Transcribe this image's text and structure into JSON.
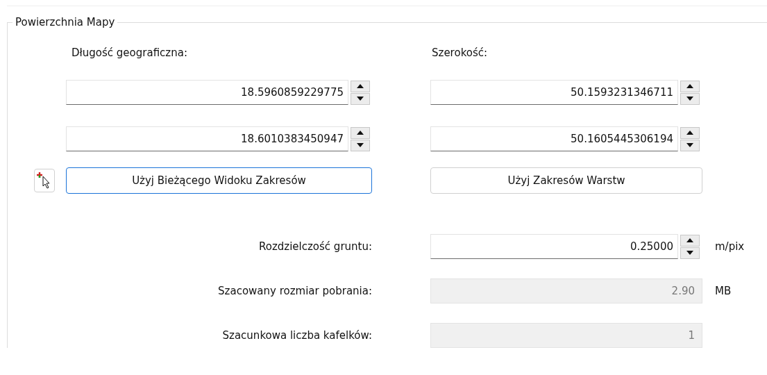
{
  "group": {
    "title": "Powierzchnia Mapy"
  },
  "columns": [
    {
      "label": "Długość geograficzna:",
      "fields": [
        {
          "value": "18.5960859229775"
        },
        {
          "value": "18.6010383450947"
        }
      ],
      "button": {
        "label": "Użyj Bieżącego Widoku Zakresów",
        "focused": true
      }
    },
    {
      "label": "Szerokość:",
      "fields": [
        {
          "value": "50.1593231346711"
        },
        {
          "value": "50.1605445306194"
        }
      ],
      "button": {
        "label": "Użyj Zakresów Warstw",
        "focused": false
      }
    }
  ],
  "rows": [
    {
      "kind": "spinbox",
      "label": "Rozdzielczość gruntu:",
      "value": "0.25000",
      "unit": "m/pix",
      "disabled": false
    },
    {
      "kind": "display",
      "label": "Szacowany rozmiar pobrania:",
      "value": "2.90",
      "unit": "MB",
      "disabled": true
    },
    {
      "kind": "display",
      "label": "Szacunkowa liczba kafelków:",
      "value": "1",
      "disabled": true
    }
  ]
}
